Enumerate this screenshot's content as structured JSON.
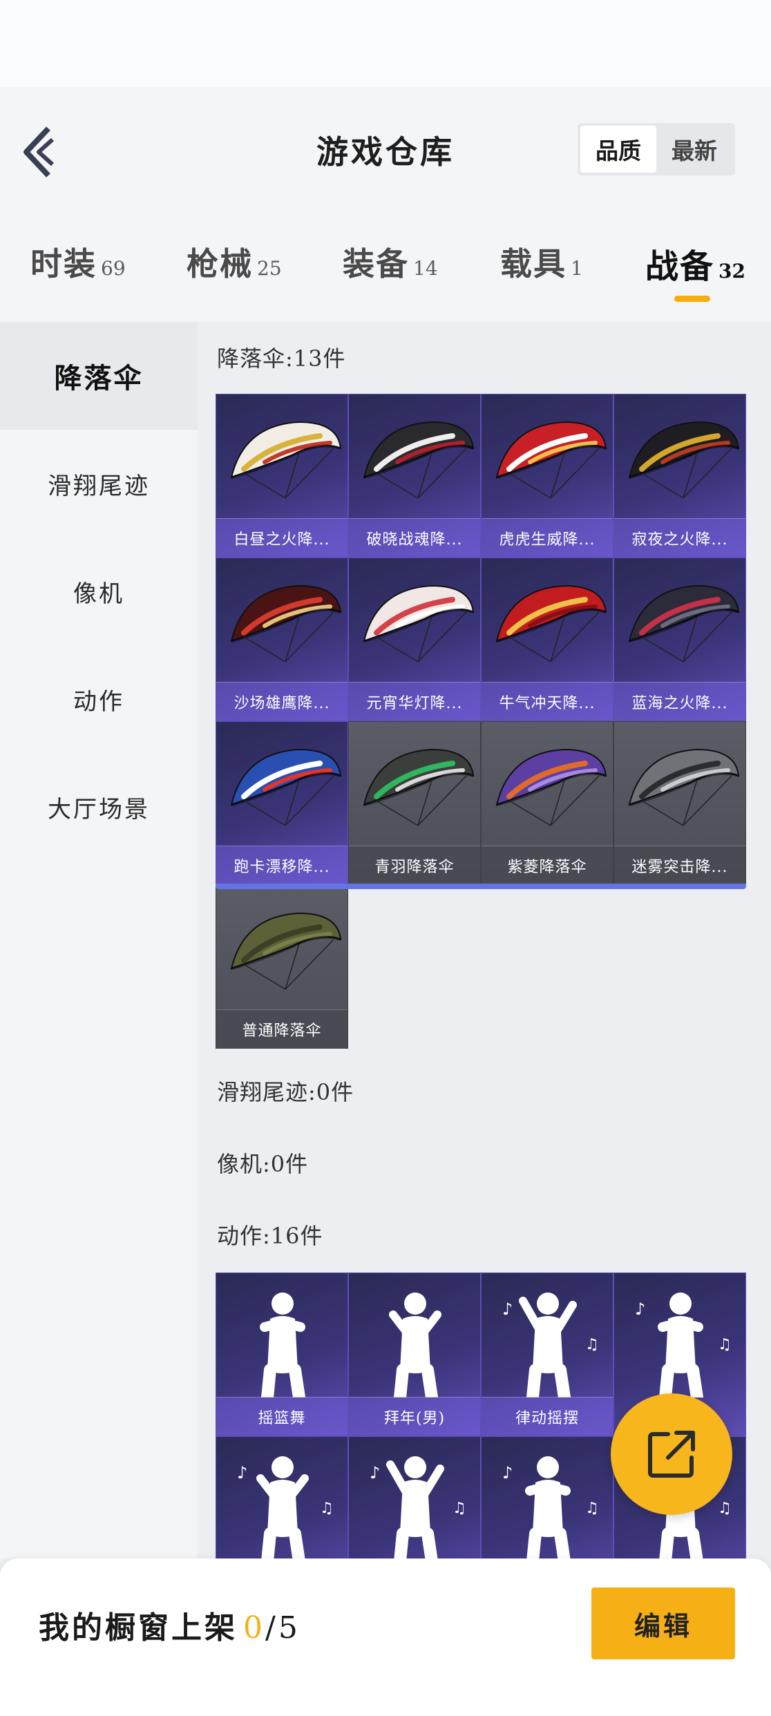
{
  "header": {
    "title": "游戏仓库",
    "sort_options": [
      "品质",
      "最新"
    ],
    "active_sort": "品质"
  },
  "tabs": [
    {
      "label": "时装",
      "count": "69"
    },
    {
      "label": "枪械",
      "count": "25"
    },
    {
      "label": "装备",
      "count": "14"
    },
    {
      "label": "载具",
      "count": "1"
    },
    {
      "label": "战备",
      "count": "32"
    }
  ],
  "active_tab": "战备",
  "sidebar": {
    "items": [
      "降落伞",
      "滑翔尾迹",
      "像机",
      "动作",
      "大厅场景"
    ],
    "active": "降落伞"
  },
  "sections": {
    "parachute": {
      "title": "降落伞:13件",
      "items": [
        {
          "name": "白昼之火降...",
          "rarity": "purple",
          "colors": [
            "#f2eee6",
            "#d9b23a",
            "#c0392b"
          ]
        },
        {
          "name": "破晓战魂降...",
          "rarity": "purple",
          "colors": [
            "#2a2a2e",
            "#eeeeee",
            "#b11f2b"
          ]
        },
        {
          "name": "虎虎生威降...",
          "rarity": "purple",
          "colors": [
            "#c91f26",
            "#ffffff",
            "#f2c04a"
          ]
        },
        {
          "name": "寂夜之火降...",
          "rarity": "purple",
          "colors": [
            "#1e1e22",
            "#d4a62c",
            "#b73a22"
          ]
        },
        {
          "name": "沙场雄鹰降...",
          "rarity": "purple",
          "colors": [
            "#4a1414",
            "#d23a2e",
            "#e5c27a"
          ]
        },
        {
          "name": "元宵华灯降...",
          "rarity": "purple",
          "colors": [
            "#f1e7e4",
            "#d4424a",
            "#ffffff"
          ]
        },
        {
          "name": "牛气冲天降...",
          "rarity": "purple",
          "colors": [
            "#c21c20",
            "#f0c148",
            "#8a1014"
          ]
        },
        {
          "name": "蓝海之火降...",
          "rarity": "purple",
          "colors": [
            "#2b2b3a",
            "#c43048",
            "#6b6b80"
          ]
        },
        {
          "name": "跑卡漂移降...",
          "rarity": "purple",
          "colors": [
            "#2a4fb3",
            "#ffffff",
            "#e8332a"
          ]
        },
        {
          "name": "青羽降落伞",
          "rarity": "grey",
          "colors": [
            "#3b3f3c",
            "#2fb75f",
            "#d9d9d9"
          ]
        },
        {
          "name": "紫菱降落伞",
          "rarity": "grey",
          "colors": [
            "#5b3fa3",
            "#e06a2a",
            "#a78ae0"
          ]
        },
        {
          "name": "迷雾突击降...",
          "rarity": "grey",
          "colors": [
            "#6f7278",
            "#2a2c30",
            "#c9cbd0"
          ]
        },
        {
          "name": "普通降落伞",
          "rarity": "grey",
          "colors": [
            "#5d6137",
            "#3d4024",
            "#7a7f48"
          ]
        }
      ]
    },
    "glide_trail": {
      "title": "滑翔尾迹:0件"
    },
    "camera": {
      "title": "像机:0件"
    },
    "emote": {
      "title": "动作:16件",
      "items": [
        {
          "name": "摇篮舞"
        },
        {
          "name": "拜年(男)"
        },
        {
          "name": "律动摇摆"
        },
        {
          "name": ""
        },
        {
          "name": ""
        },
        {
          "name": ""
        },
        {
          "name": ""
        },
        {
          "name": ""
        }
      ]
    }
  },
  "fab": {
    "icon": "share-external-icon"
  },
  "bottom": {
    "label": "我的橱窗上架",
    "count": "0",
    "total": "/5",
    "edit_label": "编辑"
  },
  "colors": {
    "accent": "#f6b015",
    "purple_card": "#3a3478",
    "grey_card": "#4e5159",
    "row_bar": "#6473e8"
  }
}
